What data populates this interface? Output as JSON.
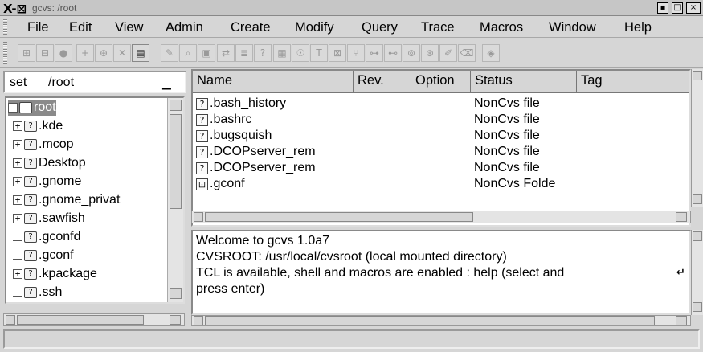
{
  "window": {
    "logo": "X-⊠",
    "title": "gcvs: /root",
    "buttons": [
      "▪",
      "□",
      "×"
    ]
  },
  "menubar": {
    "items": [
      "File",
      "Edit",
      "View",
      "Admin",
      "Create",
      "Modify",
      "Query",
      "Trace",
      "Macros",
      "Window",
      "Help"
    ]
  },
  "toolbar": {
    "icons": [
      {
        "name": "update-icon",
        "glyph": "⊞"
      },
      {
        "name": "commit-icon",
        "glyph": "⊟"
      },
      {
        "name": "record-icon",
        "glyph": "●"
      },
      {
        "name": "add-icon",
        "glyph": "+"
      },
      {
        "name": "add-binary-icon",
        "glyph": "⊕"
      },
      {
        "name": "remove-icon",
        "glyph": "✕"
      },
      {
        "name": "tree-view-icon",
        "glyph": "▤"
      },
      {
        "name": "edit-icon",
        "glyph": "✎"
      },
      {
        "name": "search-icon",
        "glyph": "⌕"
      },
      {
        "name": "view-icon",
        "glyph": "▣"
      },
      {
        "name": "diff-icon",
        "glyph": "⇄"
      },
      {
        "name": "log-icon",
        "glyph": "≣"
      },
      {
        "name": "help-icon",
        "glyph": "?"
      },
      {
        "name": "graph-icon",
        "glyph": "▦"
      },
      {
        "name": "watch-icon",
        "glyph": "☉"
      },
      {
        "name": "tag-icon",
        "glyph": "T"
      },
      {
        "name": "untag-icon",
        "glyph": "⊠"
      },
      {
        "name": "branch-icon",
        "glyph": "⑂"
      },
      {
        "name": "lock-icon",
        "glyph": "⊶"
      },
      {
        "name": "unlock-icon",
        "glyph": "⊷"
      },
      {
        "name": "editors-icon",
        "glyph": "⊚"
      },
      {
        "name": "watchers-icon",
        "glyph": "⊛"
      },
      {
        "name": "pencil-icon",
        "glyph": "✐"
      },
      {
        "name": "eraser-icon",
        "glyph": "⌫"
      },
      {
        "name": "stop-icon",
        "glyph": "◈"
      }
    ]
  },
  "leftpane": {
    "set_label": "set",
    "set_value": "/root",
    "set_arrow": "▁",
    "tree": [
      {
        "label": "root",
        "exp": "-",
        "depth": 0,
        "selected": true
      },
      {
        "label": ".kde",
        "exp": "+",
        "depth": 1
      },
      {
        "label": ".mcop",
        "exp": "+",
        "depth": 1
      },
      {
        "label": "Desktop",
        "exp": "+",
        "depth": 1
      },
      {
        "label": ".gnome",
        "exp": "+",
        "depth": 1
      },
      {
        "label": ".gnome_privat",
        "exp": "+",
        "depth": 1
      },
      {
        "label": ".sawfish",
        "exp": "+",
        "depth": 1
      },
      {
        "label": ".gconfd",
        "exp": "",
        "depth": 1
      },
      {
        "label": ".gconf",
        "exp": "",
        "depth": 1
      },
      {
        "label": ".kpackage",
        "exp": "+",
        "depth": 1
      },
      {
        "label": ".ssh",
        "exp": "",
        "depth": 1
      }
    ]
  },
  "filelist": {
    "columns": [
      "Name",
      "Rev.",
      "Option",
      "Status",
      "Tag"
    ],
    "rows": [
      {
        "name": ".bash_history",
        "icon": "?",
        "status": "NonCvs file"
      },
      {
        "name": ".bashrc",
        "icon": "?",
        "status": "NonCvs file"
      },
      {
        "name": ".bugsquish",
        "icon": "?",
        "status": "NonCvs file"
      },
      {
        "name": ".DCOPserver_rem",
        "icon": "?",
        "status": "NonCvs file"
      },
      {
        "name": ".DCOPserver_rem",
        "icon": "?",
        "status": "NonCvs file"
      },
      {
        "name": ".gconf",
        "icon": "⊡",
        "status": "NonCvs Folde"
      }
    ]
  },
  "console": {
    "lines": [
      "Welcome to gcvs 1.0a7",
      "CVSROOT: /usr/local/cvsroot (local mounted directory)",
      "TCL is available, shell and macros are enabled : help (select and",
      "press enter)"
    ],
    "wrap_marker": "↵"
  },
  "statusbar": {
    "text": ""
  }
}
